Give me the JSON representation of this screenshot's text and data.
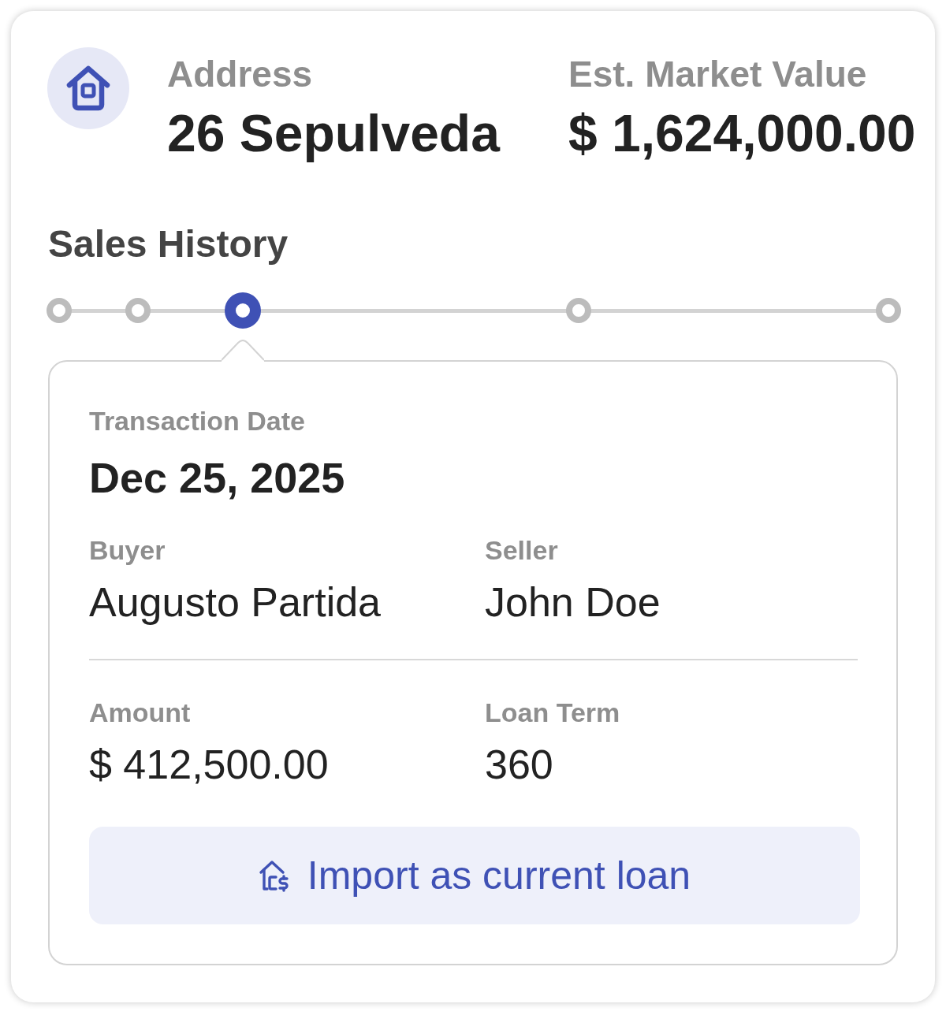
{
  "property": {
    "address_label": "Address",
    "address": "26 Sepulveda",
    "value_label": "Est. Market Value",
    "value": "$ 1,624,000.00"
  },
  "sales_history": {
    "title": "Sales History",
    "timeline": [
      {
        "selected": false
      },
      {
        "selected": false
      },
      {
        "selected": true
      },
      {
        "selected": false
      },
      {
        "selected": false
      }
    ]
  },
  "transaction": {
    "date_label": "Transaction Date",
    "date": "Dec 25, 2025",
    "parties": [
      {
        "label": "Buyer",
        "value": "Augusto Partida"
      },
      {
        "label": "Seller",
        "value": "John Doe"
      }
    ],
    "loan": [
      {
        "label": "Amount",
        "value": "$ 412,500.00"
      },
      {
        "label": "Loan Term",
        "value": "360"
      }
    ]
  },
  "button": {
    "label": "Import as current loan"
  }
}
